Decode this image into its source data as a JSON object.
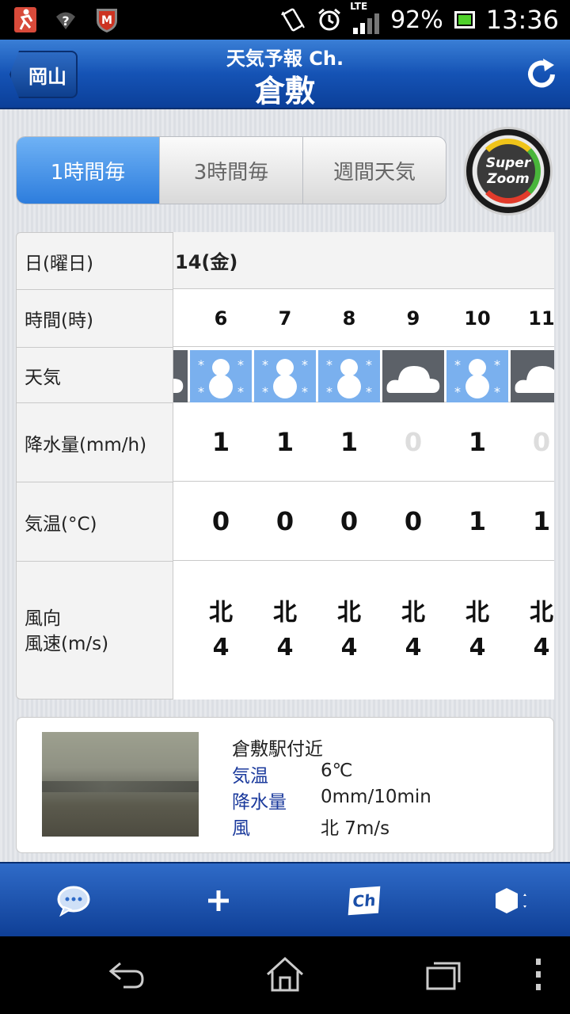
{
  "status_bar": {
    "network": "LTE",
    "battery": "92%",
    "time": "13:36",
    "icons": [
      "runner-icon",
      "wifi-question-icon",
      "mcafee-icon",
      "vibrate-icon",
      "alarm-icon",
      "signal-icon",
      "battery-icon"
    ]
  },
  "header": {
    "back_label": "岡山",
    "app_name": "天気予報 Ch.",
    "title": "倉敷",
    "refresh_icon": "refresh-icon"
  },
  "tabs": [
    {
      "label": "1時間毎",
      "selected": true
    },
    {
      "label": "3時間毎",
      "selected": false
    },
    {
      "label": "週間天気",
      "selected": false
    }
  ],
  "super_zoom": {
    "line1": "Super",
    "line2": "Zoom"
  },
  "forecast": {
    "row_labels": {
      "date": "日(曜日)",
      "hour": "時間(時)",
      "weather": "天気",
      "precip": "降水量(mm/h)",
      "temp": "気温(°C)",
      "wind_dir": "風向",
      "wind_speed": "風速(m/s)"
    },
    "date": "14(金)",
    "hours": [
      "6",
      "7",
      "8",
      "9",
      "10",
      "11"
    ],
    "weather": [
      "snow",
      "snow",
      "snow",
      "cloudy",
      "snow",
      "cloudy"
    ],
    "precip": [
      "1",
      "1",
      "1",
      "0",
      "1",
      "0"
    ],
    "temp": [
      "0",
      "0",
      "0",
      "0",
      "1",
      "1"
    ],
    "wind_dir": [
      "北",
      "北",
      "北",
      "北",
      "北",
      "北"
    ],
    "wind_speed": [
      "4",
      "4",
      "4",
      "4",
      "4",
      "4"
    ]
  },
  "camera": {
    "location": "倉敷駅付近",
    "rows": [
      {
        "key": "気温",
        "value": "6℃"
      },
      {
        "key": "降水量",
        "value": "0mm/10min"
      },
      {
        "key": "風",
        "value": "北 7m/s"
      }
    ]
  },
  "toolbar": [
    "chat-bubble-icon",
    "plus-icon",
    "channel-icon",
    "settings-hex-icon"
  ],
  "toolbar_ch_label": "Ch",
  "nav": [
    "back-icon",
    "home-icon",
    "recent-apps-icon",
    "menu-icon"
  ],
  "colors": {
    "header_blue": "#1553b5",
    "tab_selected": "#2d7ddd",
    "label_blue": "#1b3a9c",
    "snow_bg": "#7ab0ee",
    "cloud_bg": "#5c6168"
  }
}
